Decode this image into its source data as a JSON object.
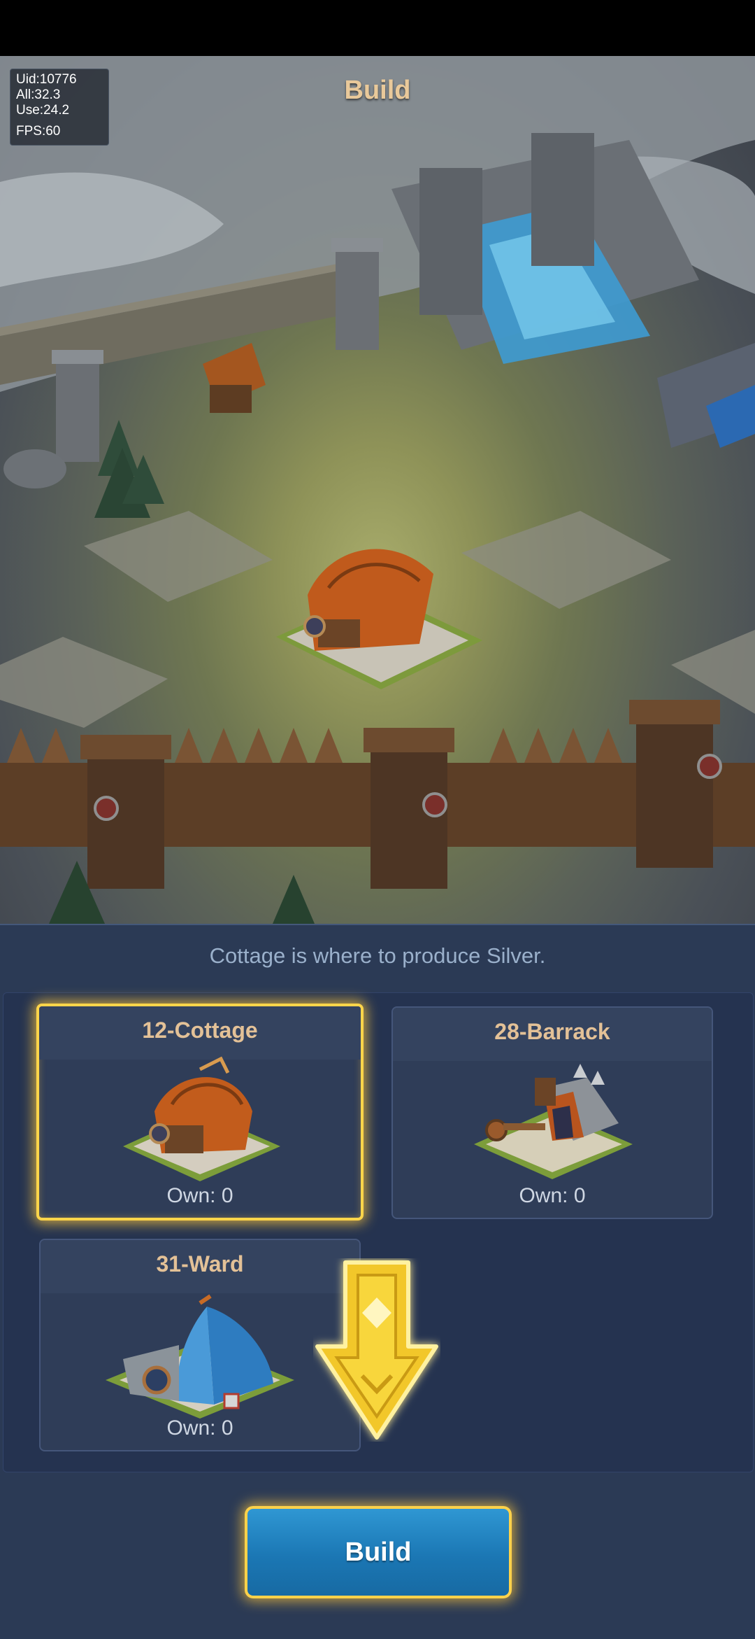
{
  "header": {
    "title": "Build"
  },
  "debug": {
    "uid": "Uid:10776",
    "all": "All:32.3",
    "use": "Use:24.2",
    "fps": "FPS:60"
  },
  "panel": {
    "description": "Cottage is where to produce Silver.",
    "cards": [
      {
        "title": "12-Cottage",
        "own": "Own: 0",
        "selected": true
      },
      {
        "title": "28-Barrack",
        "own": "Own: 0",
        "selected": false
      },
      {
        "title": "31-Ward",
        "own": "Own: 0",
        "selected": false
      }
    ],
    "build_label": "Build"
  },
  "colors": {
    "accent_gold": "#ffd54a",
    "button_blue": "#1f7fbf",
    "panel_bg": "#2b3a55"
  }
}
